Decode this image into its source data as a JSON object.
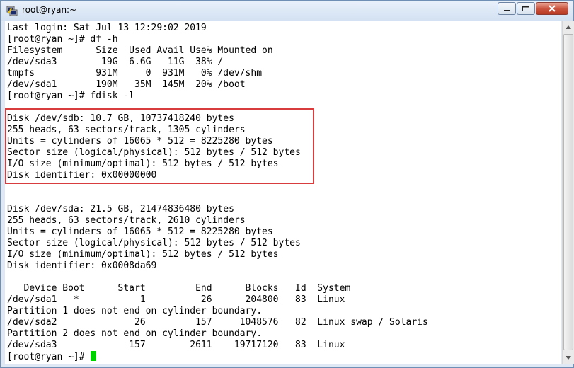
{
  "window": {
    "title": "root@ryan:~"
  },
  "terminal": {
    "lines": [
      "Last login: Sat Jul 13 12:29:02 2019",
      "[root@ryan ~]# df -h",
      "Filesystem      Size  Used Avail Use% Mounted on",
      "/dev/sda3        19G  6.6G   11G  38% /",
      "tmpfs           931M     0  931M   0% /dev/shm",
      "/dev/sda1       190M   35M  145M  20% /boot",
      "[root@ryan ~]# fdisk -l",
      "",
      "Disk /dev/sdb: 10.7 GB, 10737418240 bytes",
      "255 heads, 63 sectors/track, 1305 cylinders",
      "Units = cylinders of 16065 * 512 = 8225280 bytes",
      "Sector size (logical/physical): 512 bytes / 512 bytes",
      "I/O size (minimum/optimal): 512 bytes / 512 bytes",
      "Disk identifier: 0x00000000",
      "",
      "",
      "Disk /dev/sda: 21.5 GB, 21474836480 bytes",
      "255 heads, 63 sectors/track, 2610 cylinders",
      "Units = cylinders of 16065 * 512 = 8225280 bytes",
      "Sector size (logical/physical): 512 bytes / 512 bytes",
      "I/O size (minimum/optimal): 512 bytes / 512 bytes",
      "Disk identifier: 0x0008da69",
      "",
      "   Device Boot      Start         End      Blocks   Id  System",
      "/dev/sda1   *           1          26      204800   83  Linux",
      "Partition 1 does not end on cylinder boundary.",
      "/dev/sda2              26         157     1048576   82  Linux swap / Solaris",
      "Partition 2 does not end on cylinder boundary.",
      "/dev/sda3             157        2611    19717120   83  Linux",
      "[root@ryan ~]# "
    ],
    "cursor_color": "#00d000",
    "highlight_color": "#d93c3c"
  },
  "icons": {
    "app": "putty-icon",
    "minimize": "minimize-icon",
    "maximize": "maximize-icon",
    "close": "close-icon"
  }
}
